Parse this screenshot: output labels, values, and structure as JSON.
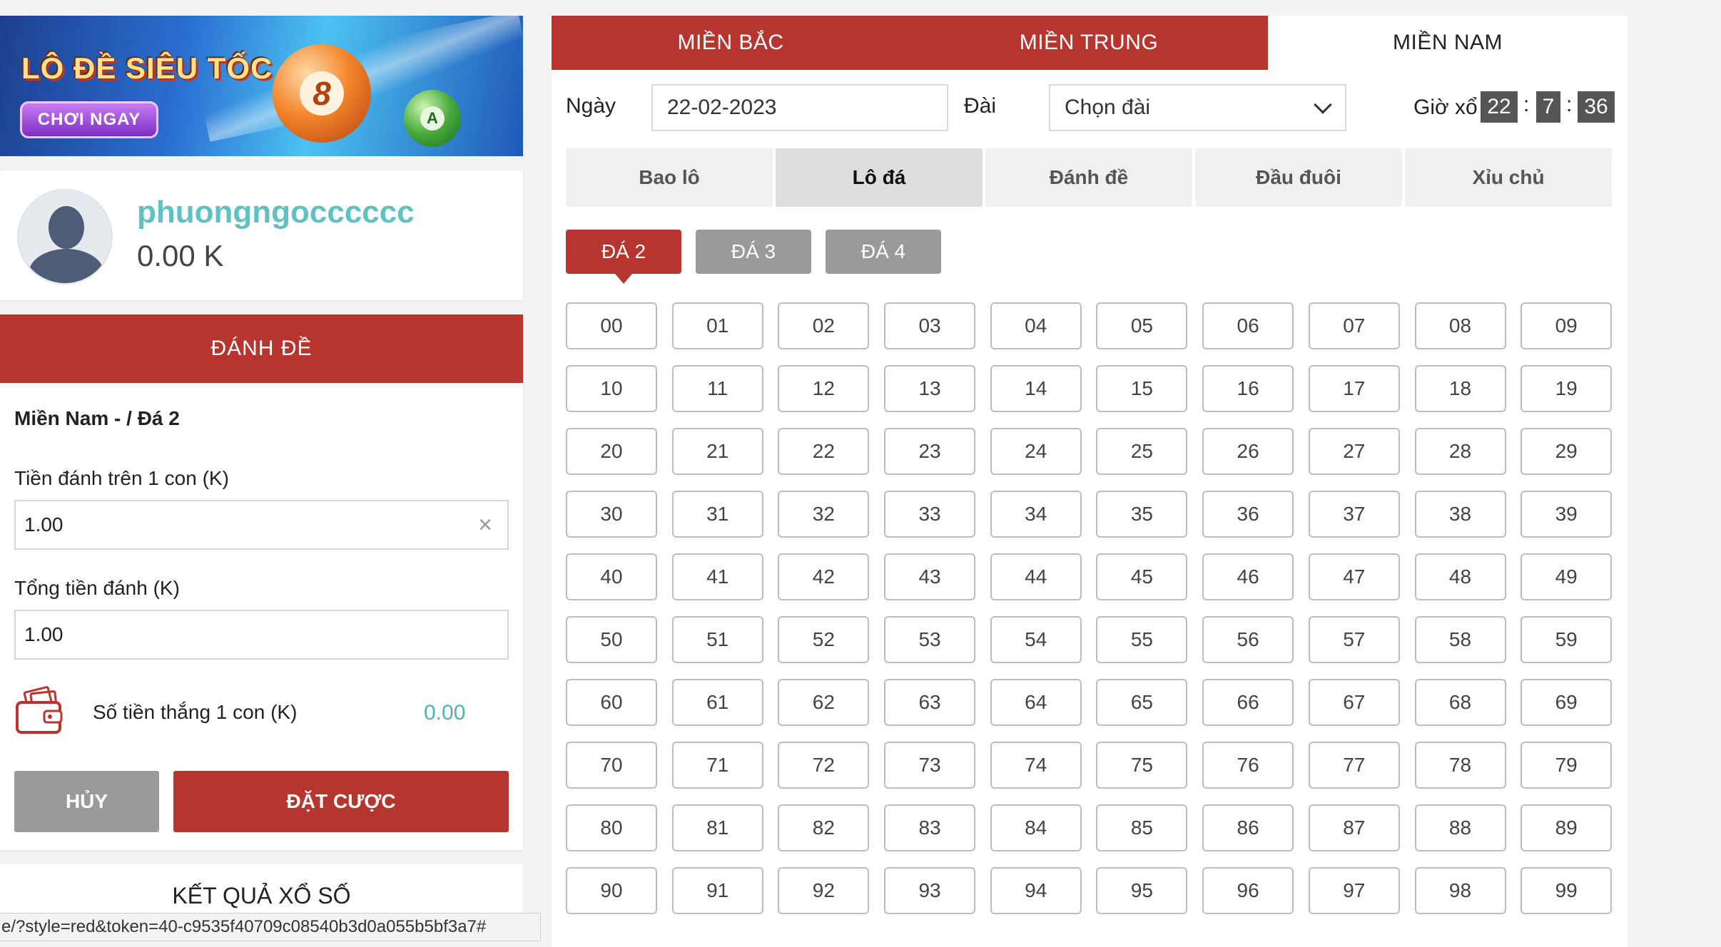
{
  "banner": {
    "title": "LÔ ĐỀ SIÊU TỐC",
    "cta": "CHƠI NGAY",
    "ball_big": "8",
    "ball_small": "A"
  },
  "profile": {
    "username": "phuongngocccccc",
    "balance": "0.00 K"
  },
  "bet": {
    "header": "ĐÁNH ĐỀ",
    "selection": "Miền Nam - / Đá 2",
    "stake_label": "Tiền đánh trên 1 con (K)",
    "stake_value": "1.00",
    "total_label": "Tổng tiền đánh (K)",
    "total_value": "1.00",
    "win_label": "Số tiền thắng 1 con (K)",
    "win_value": "0.00",
    "cancel": "HỦY",
    "place": "ĐẶT CƯỢC"
  },
  "results": {
    "title": "KẾT QUẢ XỔ SỐ"
  },
  "status_url": "e/?style=red&token=40-c9535f40709c08540b3d0a055b5bf3a7#",
  "regions": [
    {
      "label": "MIỀN BẮC",
      "active": false
    },
    {
      "label": "MIỀN TRUNG",
      "active": false
    },
    {
      "label": "MIỀN NAM",
      "active": true
    }
  ],
  "filters": {
    "date_label": "Ngày",
    "date_value": "22-02-2023",
    "station_label": "Đài",
    "station_value": "Chọn đài",
    "time_label": "Giờ xổ",
    "time_h": "22",
    "time_m": "7",
    "time_s": "36",
    "sep": ":"
  },
  "bet_types": [
    {
      "label": "Bao lô",
      "active": false
    },
    {
      "label": "Lô đá",
      "active": true
    },
    {
      "label": "Đánh đề",
      "active": false
    },
    {
      "label": "Đầu đuôi",
      "active": false
    },
    {
      "label": "Xỉu chủ",
      "active": false
    }
  ],
  "sub_types": [
    {
      "label": "ĐÁ 2",
      "active": true
    },
    {
      "label": "ĐÁ 3",
      "active": false
    },
    {
      "label": "ĐÁ 4",
      "active": false
    }
  ],
  "numbers": [
    "00",
    "01",
    "02",
    "03",
    "04",
    "05",
    "06",
    "07",
    "08",
    "09",
    "10",
    "11",
    "12",
    "13",
    "14",
    "15",
    "16",
    "17",
    "18",
    "19",
    "20",
    "21",
    "22",
    "23",
    "24",
    "25",
    "26",
    "27",
    "28",
    "29",
    "30",
    "31",
    "32",
    "33",
    "34",
    "35",
    "36",
    "37",
    "38",
    "39",
    "40",
    "41",
    "42",
    "43",
    "44",
    "45",
    "46",
    "47",
    "48",
    "49",
    "50",
    "51",
    "52",
    "53",
    "54",
    "55",
    "56",
    "57",
    "58",
    "59",
    "60",
    "61",
    "62",
    "63",
    "64",
    "65",
    "66",
    "67",
    "68",
    "69",
    "70",
    "71",
    "72",
    "73",
    "74",
    "75",
    "76",
    "77",
    "78",
    "79",
    "80",
    "81",
    "82",
    "83",
    "84",
    "85",
    "86",
    "87",
    "88",
    "89",
    "90",
    "91",
    "92",
    "93",
    "94",
    "95",
    "96",
    "97",
    "98",
    "99"
  ],
  "colors": {
    "primary": "#b7352f",
    "accent": "#5fc1c1",
    "neutral_button": "#9a9a9a"
  }
}
